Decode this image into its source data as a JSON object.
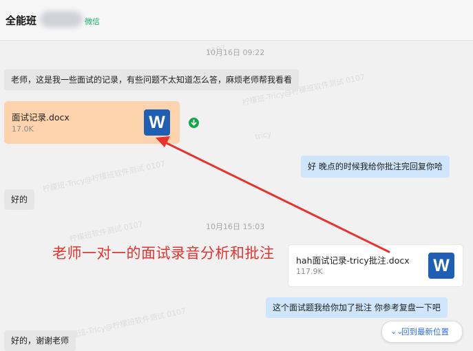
{
  "header": {
    "title": "全能班",
    "source_tag": "微信"
  },
  "timestamps": [
    "10月16日 09:22",
    "10月16日 15:03"
  ],
  "messages": {
    "m1": "老师，这是我一些面试的记录，有些问题不太知道怎么答，麻烦老师帮我看看",
    "m2": "好 晚点的时候我给你批注完回复你哈",
    "m3": "好的",
    "m4": "这个面试题我给你加了批注 你参考复盘一下吧",
    "m5": "好的，谢谢老师"
  },
  "files": [
    {
      "name": "面试记录.docx",
      "size": "17.0K",
      "icon_letter": "W",
      "color": "#fcd3ad"
    },
    {
      "name": "hah面试记录-tricy批注.docx",
      "size": "117.9K",
      "icon_letter": "W",
      "color": "#ffffff"
    }
  ],
  "annotation": "老师一对一的面试录音分析和批注",
  "jump_button": {
    "label": "回到最新位置",
    "icon": "double-chevron-down-icon"
  },
  "watermark": [
    "柠檬班-tricy",
    "柠檬班-Tricy@柠檬班软件测试 0107",
    "tricy",
    "0107",
    "柠檬班软件测试 0107",
    "Tricy"
  ],
  "colors": {
    "arrow": "#e8322d",
    "left_bubble": "#e6e6e6",
    "right_bubble": "#cfe5fb",
    "word": "#1e5fb3",
    "link": "#2f6fe0"
  }
}
